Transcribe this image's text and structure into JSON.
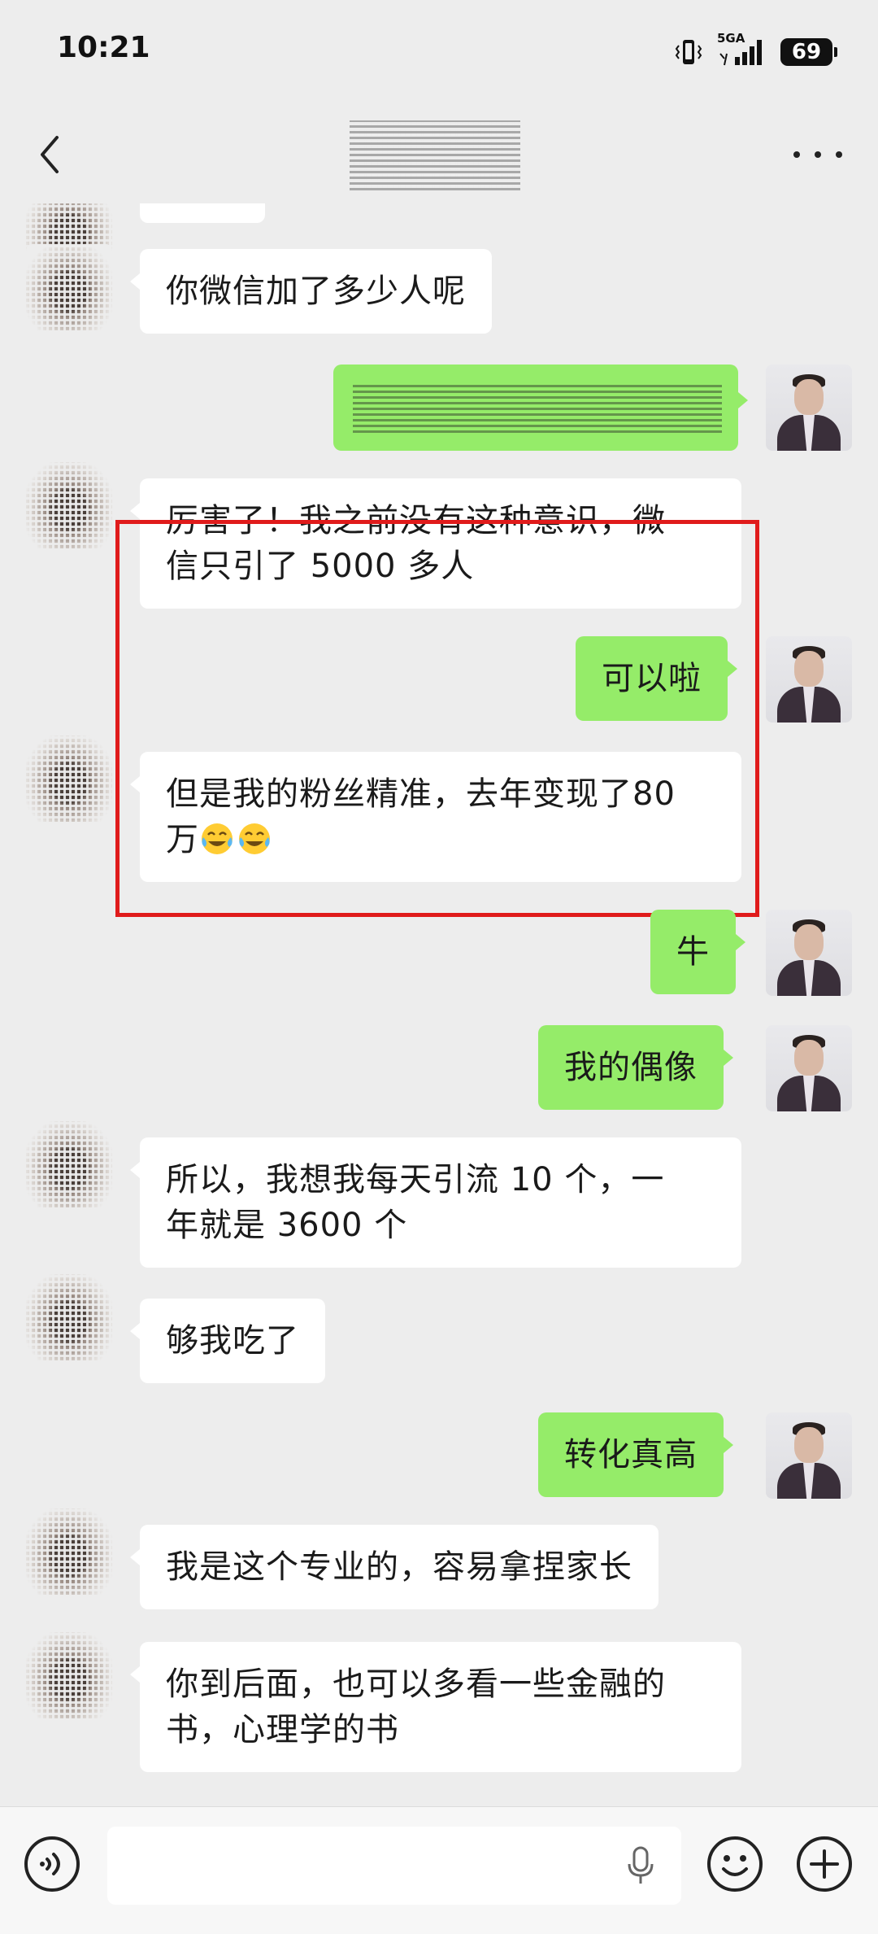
{
  "status_bar": {
    "time": "10:21",
    "network": "5GA",
    "battery": "69"
  },
  "nav": {
    "back_icon": "chevron-left-icon",
    "more_icon": "more-dots-icon"
  },
  "messages": [
    {
      "sender": "contact",
      "text": "你微信加了多少人呢"
    },
    {
      "sender": "self",
      "text": ""
    },
    {
      "sender": "contact",
      "lines": [
        "厉害了！我之前没有这种意识，微",
        "信只引了 5000 多人"
      ]
    },
    {
      "sender": "self",
      "text": "可以啦"
    },
    {
      "sender": "contact",
      "lines": [
        "但是我的粉丝精准，去年变现了80",
        "万"
      ],
      "emoji": "tears-of-joy-emoji"
    },
    {
      "sender": "self",
      "text": "牛"
    },
    {
      "sender": "self",
      "text": "我的偶像"
    },
    {
      "sender": "contact",
      "lines": [
        "所以，我想我每天引流 10 个，一",
        "年就是 3600 个"
      ]
    },
    {
      "sender": "contact",
      "text": "够我吃了"
    },
    {
      "sender": "self",
      "text": "转化真高"
    },
    {
      "sender": "contact",
      "text": "我是这个专业的，容易拿捏家长"
    },
    {
      "sender": "contact",
      "lines": [
        "你到后面，也可以多看一些金融的",
        "书，心理学的书"
      ]
    }
  ],
  "highlight_color": "#e01b1b",
  "bubble_colors": {
    "incoming": "#ffffff",
    "outgoing": "#95ec69"
  },
  "input_bar": {
    "voice_icon": "voice-icon",
    "mic_icon": "microphone-icon",
    "emoji_icon": "smiley-icon",
    "plus_icon": "plus-circle-icon",
    "text_value": ""
  }
}
